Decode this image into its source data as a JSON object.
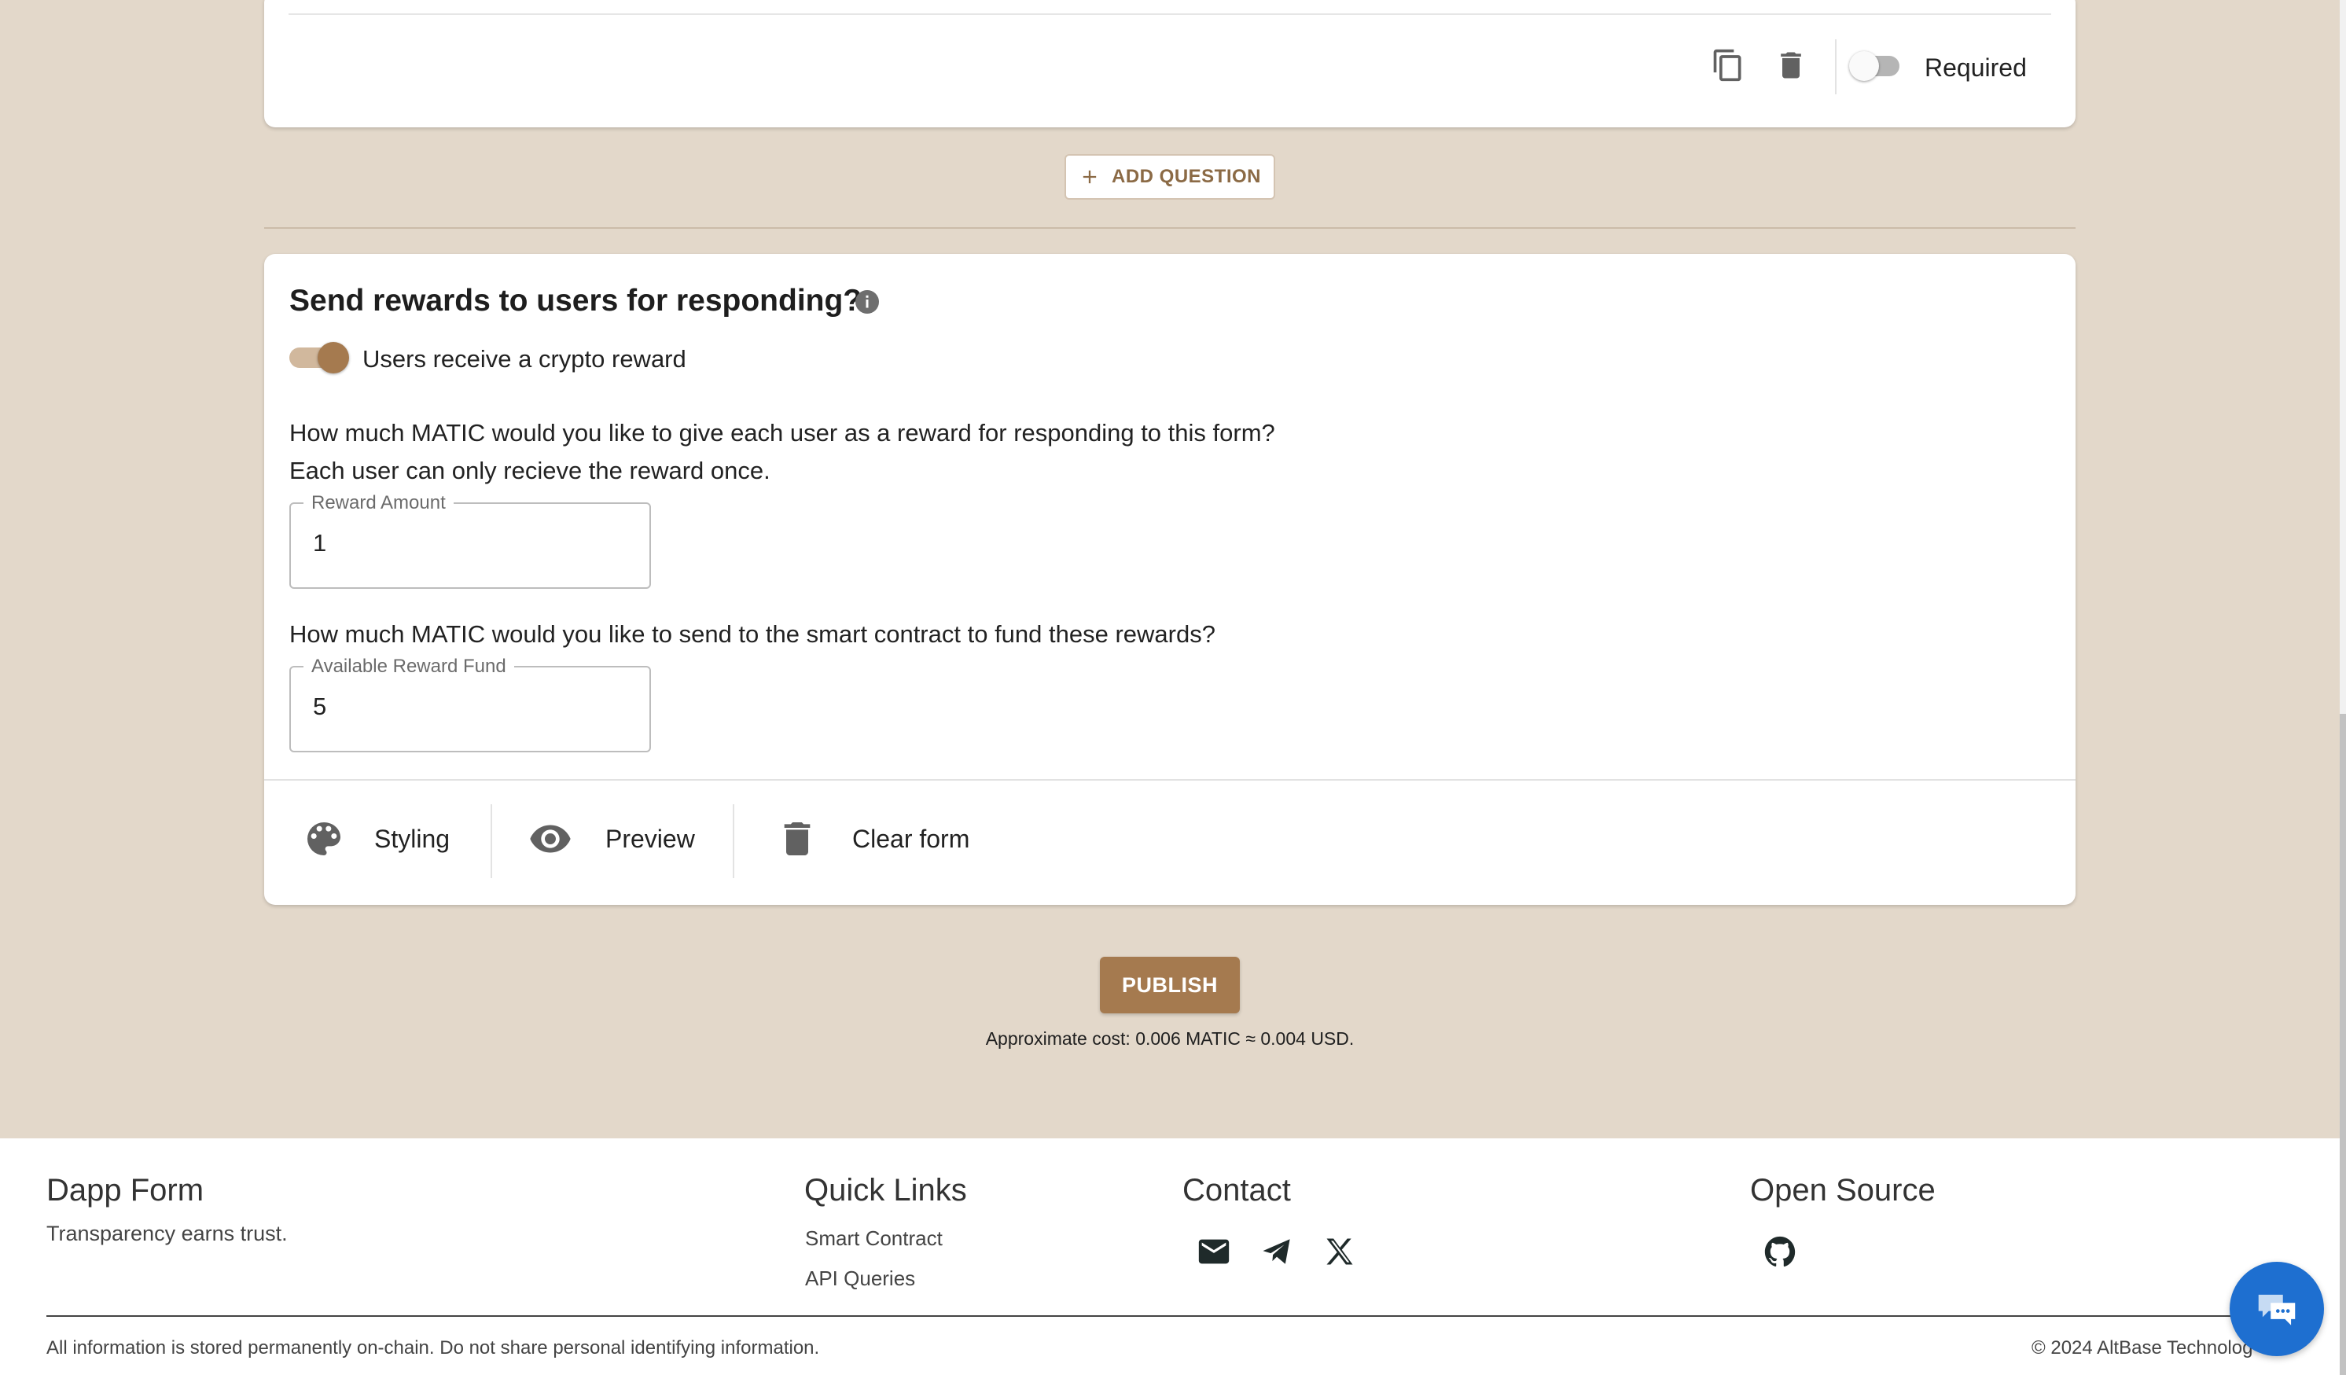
{
  "question_card": {
    "required_label": "Required",
    "required_on": false
  },
  "add_question_label": "ADD QUESTION",
  "rewards": {
    "heading": "Send rewards to users for responding?",
    "toggle_label": "Users receive a crypto reward",
    "toggle_on": true,
    "question1_line1": "How much MATIC would you like to give each user as a reward for responding to this form?",
    "question1_line2": "Each user can only recieve the reward once.",
    "reward_amount_label": "Reward Amount",
    "reward_amount_value": "1",
    "question2": "How much MATIC would you like to send to the smart contract to fund these rewards?",
    "fund_label": "Available Reward Fund",
    "fund_value": "5"
  },
  "toolbar": {
    "styling_label": "Styling",
    "preview_label": "Preview",
    "clear_label": "Clear form"
  },
  "publish_label": "PUBLISH",
  "cost_text": "Approximate cost: 0.006 MATIC ≈ 0.004 USD.",
  "footer": {
    "brand": "Dapp Form",
    "tagline": "Transparency earns trust.",
    "quick_links_title": "Quick Links",
    "links": [
      "Smart Contract",
      "API Queries"
    ],
    "contact_title": "Contact",
    "contact_icons": [
      "email-icon",
      "telegram-icon",
      "x-icon"
    ],
    "open_source_title": "Open Source",
    "open_source_icon": "github-icon",
    "disclaimer": "All information is stored permanently on-chain. Do not share personal identifying information.",
    "copyright": "© 2024 AltBase Technolog"
  },
  "colors": {
    "page_bg": "#e3d8ca",
    "accent": "#a57a4f",
    "chat_button": "#1e6fd0"
  }
}
